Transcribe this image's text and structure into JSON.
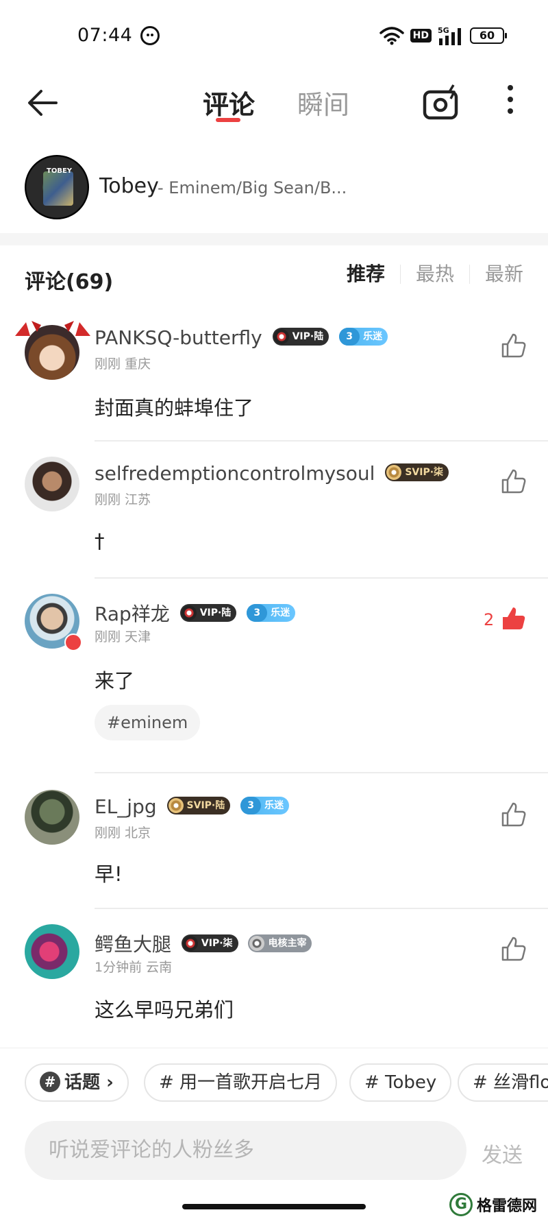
{
  "status_bar": {
    "time": "07:44",
    "battery": "60",
    "hd": "HD",
    "network": "5G"
  },
  "nav": {
    "tab_comments": "评论",
    "tab_moments": "瞬间"
  },
  "song": {
    "title": "Tobey",
    "artist": "- Eminem/Big Sean/B...",
    "cover_label": "TOBEY"
  },
  "comments_header": {
    "count_label": "评论(69)",
    "sort_recommend": "推荐",
    "sort_hot": "最热",
    "sort_latest": "最新"
  },
  "comments": [
    {
      "username": "PANKSQ-butterfly",
      "badges": [
        "VIP·陆",
        "乐迷"
      ],
      "fan_level": "3",
      "meta": "刚刚 重庆",
      "text": "封面真的蚌埠住了",
      "likes": ""
    },
    {
      "username": "selfredemptioncontrolmysoul",
      "badges": [
        "SVIP·柒"
      ],
      "meta": "刚刚 江苏",
      "text": "†",
      "likes": ""
    },
    {
      "username": "Rap祥龙",
      "badges": [
        "VIP·陆",
        "乐迷"
      ],
      "fan_level": "3",
      "meta": "刚刚 天津",
      "text": "来了",
      "hashtag": "#eminem",
      "likes": "2"
    },
    {
      "username": "EL_jpg",
      "badges": [
        "SVIP·陆",
        "乐迷"
      ],
      "fan_level": "3",
      "meta": "刚刚 北京",
      "text": "早!",
      "likes": ""
    },
    {
      "username": "鳄鱼大腿",
      "badges": [
        "VIP·柒",
        "电核主宰"
      ],
      "meta": "1分钟前 云南",
      "text": "这么早吗兄弟们",
      "likes": ""
    }
  ],
  "topics": {
    "topic_label": "话题",
    "chips": [
      "# 用一首歌开启七月",
      "# Tobey",
      "# 丝滑flo"
    ]
  },
  "input": {
    "placeholder": "听说爱评论的人粉丝多",
    "send": "发送"
  },
  "watermark": {
    "text": "格雷德网",
    "logo": "G"
  },
  "colors": {
    "accent": "#ec4141",
    "muted": "#999999"
  }
}
